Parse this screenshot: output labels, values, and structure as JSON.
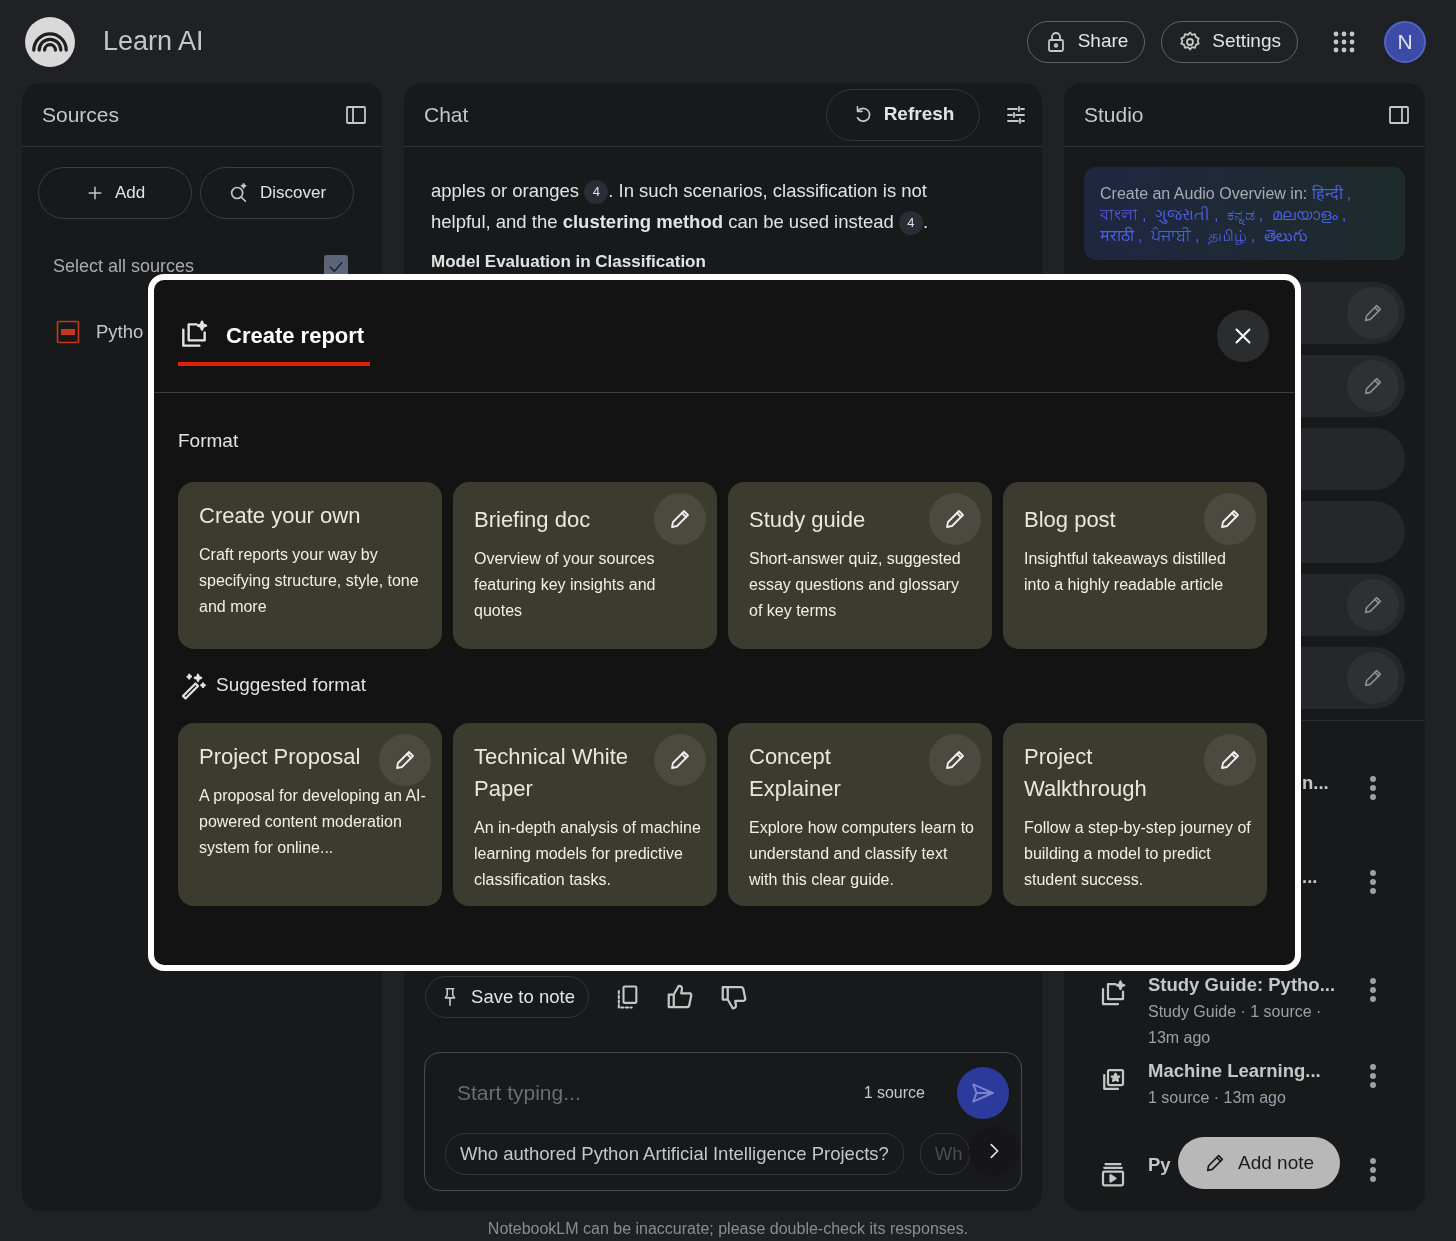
{
  "app": {
    "title": "Learn AI",
    "share": "Share",
    "settings": "Settings",
    "avatar": "N"
  },
  "sources": {
    "title": "Sources",
    "add": "Add",
    "discover": "Discover",
    "select_all": {
      "label": "Select all sources",
      "checked": true
    },
    "items": [
      {
        "name": "Pytho",
        "kind": "pdf"
      }
    ]
  },
  "chat": {
    "title": "Chat",
    "refresh": "Refresh",
    "message": [
      {
        "kind": "text",
        "text": "apples or oranges "
      },
      {
        "kind": "cite",
        "text": "4"
      },
      {
        "kind": "text",
        "text": ". In such scenarios, classification is not helpful, and the **clustering method** can be used instead "
      },
      {
        "kind": "cite",
        "text": "4"
      },
      {
        "kind": "text",
        "text": "."
      }
    ],
    "heading": "Model Evaluation in Classification",
    "save_to_note": "Save to note",
    "input": {
      "placeholder": "Start typing...",
      "source_count": "1 source"
    },
    "suggestions": [
      "Who authored Python Artificial Intelligence Projects?",
      "Wh"
    ]
  },
  "studio": {
    "title": "Studio",
    "audio_overview": {
      "text": "Create an Audio Overview in:",
      "separator": ",",
      "languages": [
        "हिन्दी",
        "বাংলা",
        "ગુજરાતી",
        "ಕನ್ನಡ",
        "മലയാളം",
        "मराठी",
        "ਪੰਜਾਬੀ",
        "தமிழ்",
        "తెలుగు"
      ]
    },
    "tools": [
      {
        "kind": "edit"
      },
      {
        "kind": "edit"
      },
      {
        "kind": "plain"
      },
      {
        "kind": "plain"
      },
      {
        "kind": "edit"
      },
      {
        "kind": "edit"
      }
    ],
    "notes": [
      {
        "kind": "partial",
        "title": "n..."
      },
      {
        "kind": "partial",
        "title": "..."
      },
      {
        "kind": "report",
        "title": "Study Guide: Pytho...",
        "meta": "Study Guide · 1 source · 13m ago"
      },
      {
        "kind": "flashcards",
        "title": "Machine Learning...",
        "meta": "1 source · 13m ago"
      },
      {
        "kind": "video",
        "title": "Py"
      }
    ],
    "add_note": "Add note"
  },
  "footer": "NotebookLM can be inaccurate; please double-check its responses.",
  "dialog": {
    "title": "Create report",
    "format_label": "Format",
    "formats": [
      {
        "title": "Create your own",
        "description": "Craft reports your way by specifying structure, style, tone and more",
        "editable": false
      },
      {
        "title": "Briefing doc",
        "description": "Overview of your sources featuring key insights and quotes",
        "editable": true
      },
      {
        "title": "Study guide",
        "description": "Short-answer quiz, suggested essay questions and glossary of key terms",
        "editable": true
      },
      {
        "title": "Blog post",
        "description": "Insightful takeaways distilled into a highly readable article",
        "editable": true
      }
    ],
    "suggested_label": "Suggested format",
    "suggested": [
      {
        "title": "Project Proposal",
        "description": "A proposal for developing an AI-powered content moderation system for online...",
        "editable": true
      },
      {
        "title": "Technical White Paper",
        "description": "An in-depth analysis of machine learning models for predictive classification tasks.",
        "editable": true
      },
      {
        "title": "Concept Explainer",
        "description": "Explore how computers learn to understand and classify text with this clear guide.",
        "editable": true
      },
      {
        "title": "Project Walkthrough",
        "description": "Follow a step-by-step journey of building a model to predict student success.",
        "editable": true
      }
    ]
  }
}
